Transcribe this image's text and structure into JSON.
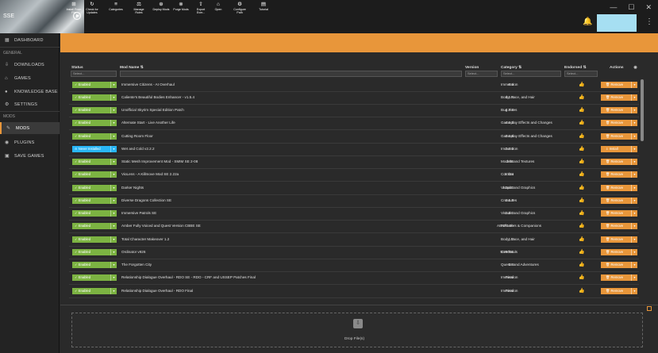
{
  "titlebar": {
    "game_abbr": "SSE",
    "win_min": "—",
    "win_max": "☐",
    "win_close": "✕"
  },
  "sidebar": {
    "top_item": "DASHBOARD",
    "section_general": "GENERAL",
    "general_items": [
      "DOWNLOADS",
      "GAMES",
      "KNOWLEDGE BASE",
      "SETTINGS"
    ],
    "section_mods": "MODS",
    "mods_items": [
      "MODS",
      "PLUGINS",
      "SAVE GAMES"
    ]
  },
  "toolbar": {
    "items": [
      [
        "Install From",
        "File"
      ],
      [
        "Check for",
        "Updates"
      ],
      [
        "Categories",
        ""
      ],
      [
        "Manage",
        "Rules"
      ],
      [
        "Deploy Mods",
        ""
      ],
      [
        "Purge Mods",
        ""
      ],
      [
        "Export",
        "Ever..."
      ],
      [
        "Open",
        ""
      ],
      [
        "Configure",
        "Path"
      ],
      [
        "Tutorial",
        ""
      ]
    ]
  },
  "table": {
    "headers": {
      "status": "Status",
      "mod_name": "Mod Name ⇅",
      "version": "Version",
      "category": "Category ⇅",
      "endorsed": "Endorsed ⇅",
      "actions": "Actions"
    },
    "filter_placeholder": "Select...",
    "rows": [
      {
        "status": "Enabled",
        "name": "Immersive Citizens - AI Overhaul",
        "version": "0.4",
        "category": "Immersion",
        "action": "Remove"
      },
      {
        "status": "Enabled",
        "name": "Caliente's Beautiful Bodies Enhancer - v1.5.4",
        "version": "1.5.4",
        "category": "Body, Face, and Hair",
        "action": "Remove"
      },
      {
        "status": "Enabled",
        "name": "Unofficial Skyrim Special Edition Patch",
        "version": "4.2.0",
        "category": "Bug Fixes",
        "action": "Remove"
      },
      {
        "status": "Enabled",
        "name": "Alternate Start - Live Another Life",
        "version": "4.1.2",
        "category": "Gameplay Effects and Changes",
        "action": "Remove"
      },
      {
        "status": "Enabled",
        "name": "Cutting Room Floor",
        "version": "3.1.6",
        "category": "Gameplay Effects and Changes",
        "action": "Remove"
      },
      {
        "status": "Never Installed",
        "name": "Wet and Cold v2.2.2",
        "version": "2.2.2",
        "category": "Immersion",
        "action": "Install"
      },
      {
        "status": "Enabled",
        "name": "Static Mesh Improvement Mod - SMIM SE 2-08",
        "version": "2.08",
        "category": "Models and Textures",
        "action": "Remove"
      },
      {
        "status": "Enabled",
        "name": "VioLens - A Killmove Mod SE 2.22a",
        "version": "2.22a",
        "category": "Combat",
        "action": "Remove"
      },
      {
        "status": "Enabled",
        "name": "Darker Nights",
        "version": "1.3p13",
        "category": "Visuals and Graphics",
        "action": "Remove"
      },
      {
        "status": "Enabled",
        "name": "Diverse Dragons Collection SE",
        "version": "2.1.3",
        "category": "Creatures",
        "action": "Remove"
      },
      {
        "status": "Enabled",
        "name": "Immersive Patrols SE",
        "version": "2.3.2",
        "category": "Visuals and Graphics",
        "action": "Remove"
      },
      {
        "status": "Enabled",
        "name": "Amber Fully Voiced and Quest Version CBBE SE",
        "version": "AESF1.0b",
        "category": "Followers & Companions",
        "action": "Remove"
      },
      {
        "status": "Enabled",
        "name": "Total Character Makeover 1.2",
        "version": "1.2",
        "category": "Body, Face, and Hair",
        "action": "Remove"
      },
      {
        "status": "Enabled",
        "name": "Ordinator v926",
        "version": "9.26000",
        "category": "Overhauls",
        "action": "Remove"
      },
      {
        "status": "Enabled",
        "name": "The Forgotten City",
        "version": "1.8",
        "category": "Quests and Adventures",
        "action": "Remove"
      },
      {
        "status": "Enabled",
        "name": "Relationship Dialogue Overhaul - RDO SE - RDO - CRF and USSEP Patches Final",
        "version": "Final",
        "category": "Immersion",
        "action": "Remove"
      },
      {
        "status": "Enabled",
        "name": "Relationship Dialogue Overhaul - RDO Final",
        "version": "Final",
        "category": "Immersion",
        "action": "Remove"
      }
    ]
  },
  "dropzone": {
    "label": "Drop File(s)"
  },
  "colors": {
    "accent": "#e8963a",
    "enabled": "#7cb342",
    "never_installed": "#29b6f6",
    "profile": "#a6dff2"
  }
}
